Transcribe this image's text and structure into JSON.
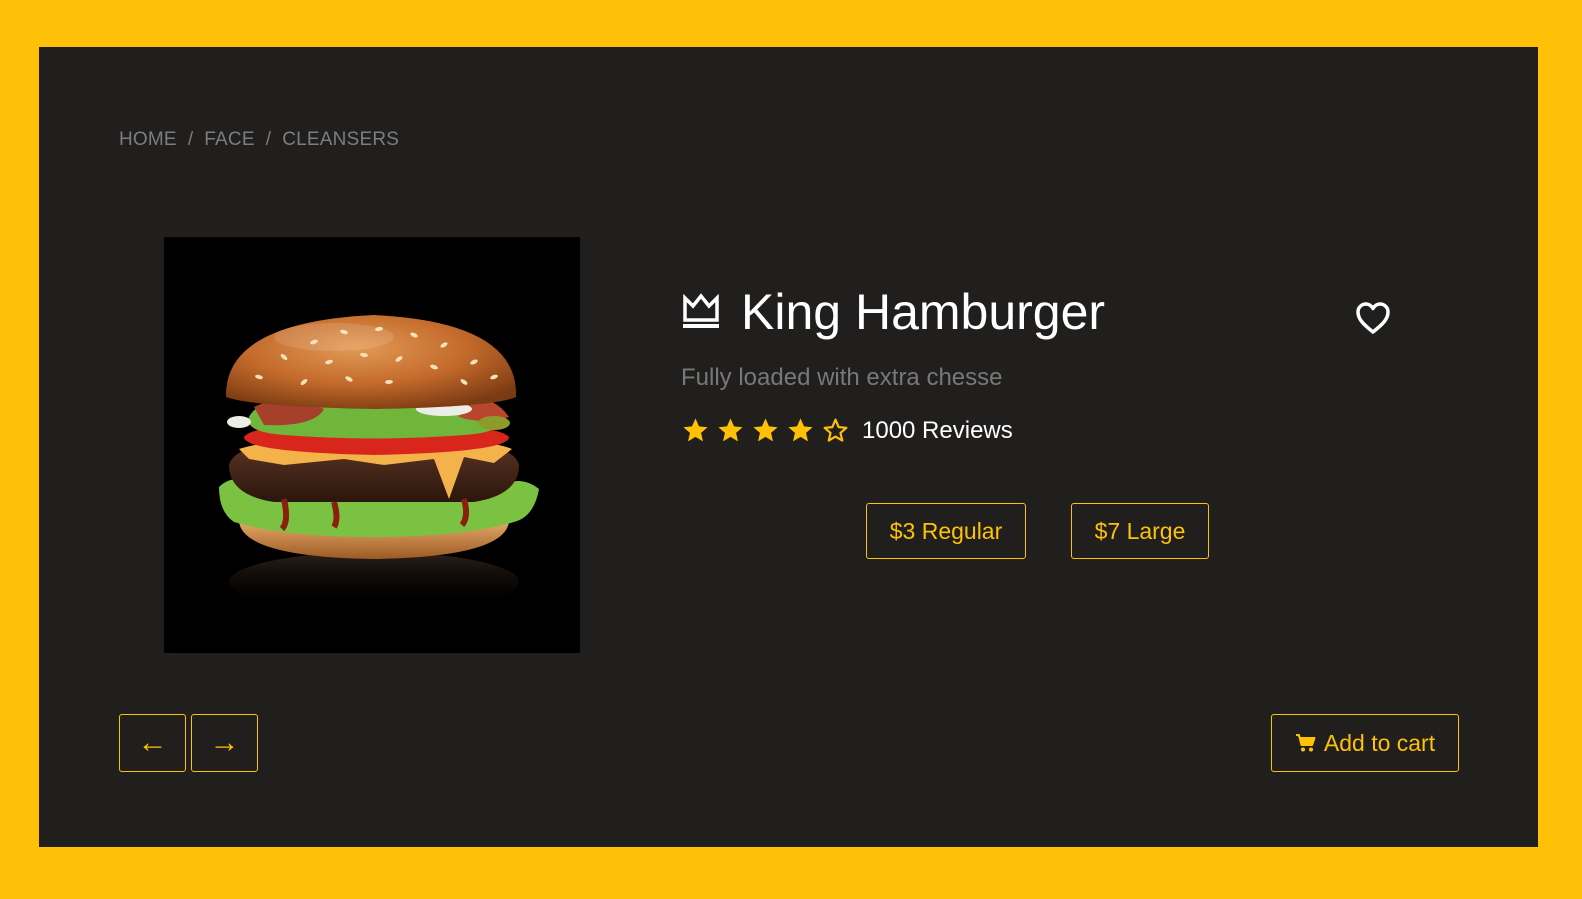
{
  "breadcrumb": {
    "items": [
      "HOME",
      "FACE",
      "CLEANSERS"
    ],
    "separator": "/"
  },
  "product": {
    "icon": "crown-icon",
    "title": "King Hamburger",
    "subtitle": "Fully loaded with extra chesse",
    "rating": {
      "filled": 4,
      "max": 5
    },
    "reviews_label": "1000 Reviews",
    "image": "hamburger-photo"
  },
  "sizes": [
    {
      "label": "$3 Regular"
    },
    {
      "label": "$7 Large"
    }
  ],
  "nav": {
    "prev_label": "←",
    "next_label": "→"
  },
  "cart": {
    "icon": "cart-icon",
    "label": "Add to cart"
  },
  "colors": {
    "accent": "#FFC107",
    "card_bg": "#201F1E",
    "muted_text": "#787878",
    "text": "#FFFFFF"
  }
}
